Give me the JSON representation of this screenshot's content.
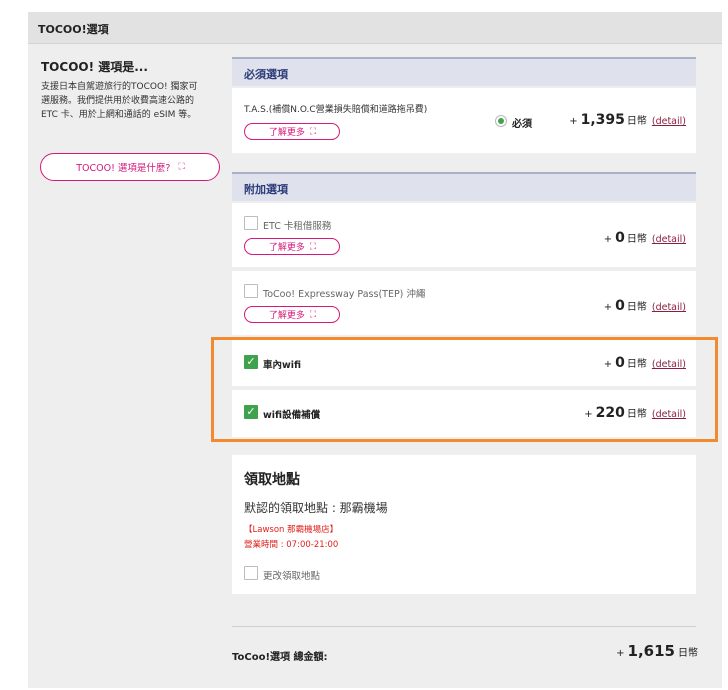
{
  "panel": {
    "title": "TOCOO!選項"
  },
  "info": {
    "title": "TOCOO! 選項是...",
    "desc_lines": [
      "支援日本自駕遊旅行的TOCOO! 獨家可",
      "選服務。我們提供用於收費高速公路的",
      "ETC 卡、用於上網和通話的 eSIM 等。"
    ],
    "what_button": "TOCOO! 選項是什麼?",
    "expand_glyph": "⛶"
  },
  "required": {
    "heading": "必須選項",
    "item": {
      "label": "T.A.S.(補償N.O.C營業損失賠償和道路拖吊費)",
      "learn_more": "了解更多",
      "radio_label": "必須",
      "price": {
        "plus": "+",
        "amount": "1,395",
        "unit": "日幣",
        "detail": "(detail)"
      }
    }
  },
  "addons": {
    "heading": "附加選項",
    "items": [
      {
        "name": "ETC 卡租借服務",
        "checked": false,
        "learn_more": "了解更多",
        "price": {
          "plus": "+",
          "amount": "0",
          "unit": "日幣",
          "detail": "(detail)"
        }
      },
      {
        "name": "ToCoo! Expressway Pass(TEP) 沖繩",
        "checked": false,
        "learn_more": "了解更多",
        "price": {
          "plus": "+",
          "amount": "0",
          "unit": "日幣",
          "detail": "(detail)"
        }
      },
      {
        "name": "車內wifi",
        "checked": true,
        "price": {
          "plus": "+",
          "amount": "0",
          "unit": "日幣",
          "detail": "(detail)"
        }
      },
      {
        "name": "wifi設備補償",
        "checked": true,
        "price": {
          "plus": "+",
          "amount": "220",
          "unit": "日幣",
          "detail": "(detail)"
        }
      }
    ]
  },
  "pickup": {
    "title": "領取地點",
    "default_location": "默認的領取地點 : 那霸機場",
    "store": "【Lawson 那霸機場店】",
    "hours": "營業時間 : 07:00-21:00",
    "change_label": "更改領取地點"
  },
  "total": {
    "label": "ToCoo!選項 總金額:",
    "plus": "+",
    "amount": "1,615",
    "unit": "日幣"
  },
  "colors": {
    "accent_pink": "#d6197a",
    "check_green": "#3fa34d",
    "highlight_orange": "#f28a30",
    "notice_red": "#e0201b"
  }
}
